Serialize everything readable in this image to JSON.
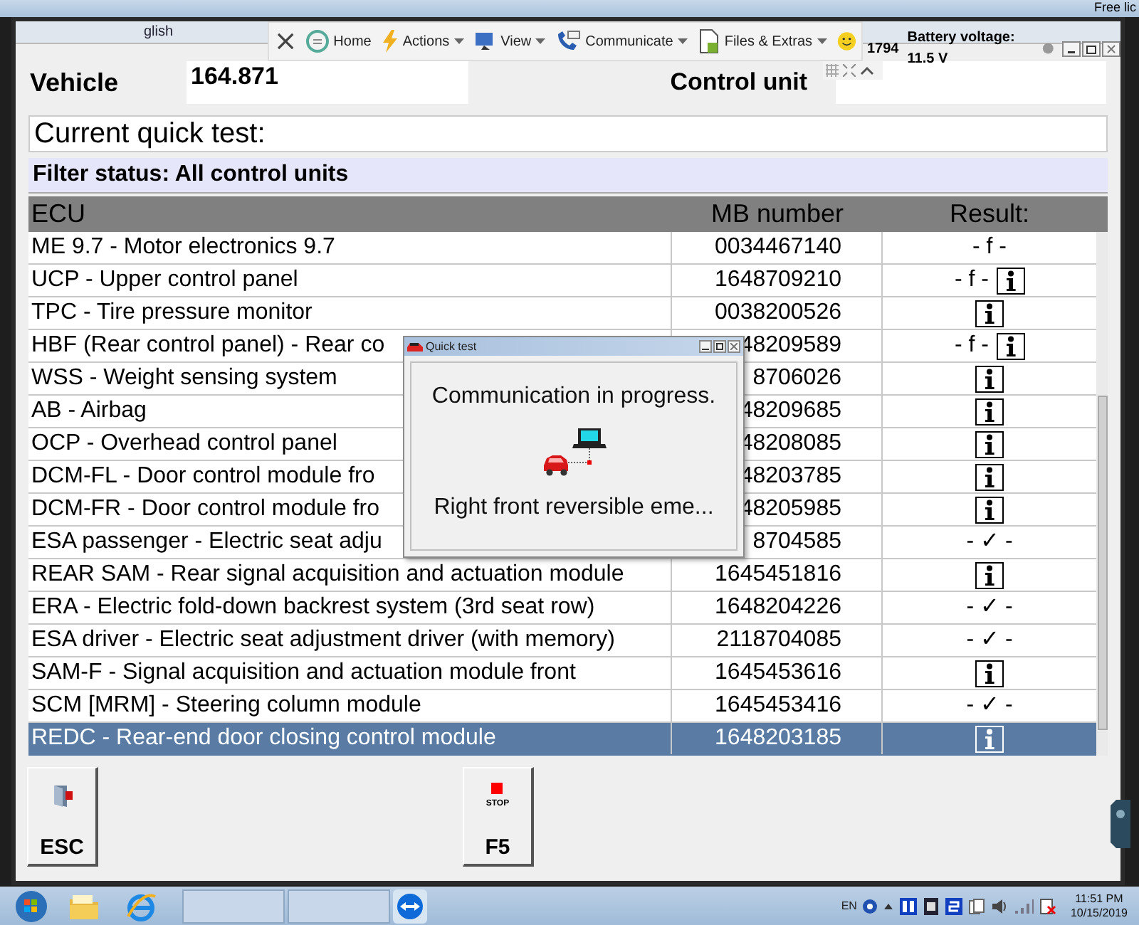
{
  "background_window": {
    "label": "Free lic"
  },
  "window": {
    "title": "glish",
    "status": "1794",
    "battery": "Battery voltage: 11.5 V"
  },
  "toolbar": [
    {
      "kind": "close"
    },
    {
      "kind": "home",
      "label": "Home",
      "dropdown": false
    },
    {
      "kind": "actions",
      "label": "Actions",
      "dropdown": true
    },
    {
      "kind": "view",
      "label": "View",
      "dropdown": true
    },
    {
      "kind": "communicate",
      "label": "Communicate",
      "dropdown": true
    },
    {
      "kind": "files",
      "label": "Files & Extras",
      "dropdown": true
    },
    {
      "kind": "smiley"
    }
  ],
  "vehicle": {
    "label": "Vehicle",
    "value": "164.871"
  },
  "control_unit": {
    "label": "Control unit"
  },
  "quick_test": "Current quick test:",
  "filter_status": "Filter status: All control units",
  "table": {
    "columns": [
      "ECU",
      "MB number",
      "Result:"
    ],
    "rows": [
      {
        "ecu": "ME 9.7 - Motor electronics 9.7",
        "mb": "0034467140",
        "result": "- f -",
        "info": false,
        "selected": false
      },
      {
        "ecu": "UCP - Upper control panel",
        "mb": "1648709210",
        "result": "- f -",
        "info": true,
        "selected": false
      },
      {
        "ecu": "TPC - Tire pressure monitor",
        "mb": "0038200526",
        "info": true,
        "selected": false
      },
      {
        "ecu": "HBF (Rear control panel) - Rear co",
        "mb": "48209589",
        "result": "- f -",
        "info": true,
        "selected": false
      },
      {
        "ecu": "WSS - Weight sensing system",
        "mb": "8706026",
        "info": true,
        "selected": false
      },
      {
        "ecu": "AB - Airbag",
        "mb": "48209685",
        "info": true,
        "selected": false
      },
      {
        "ecu": "OCP - Overhead control panel",
        "mb": "48208085",
        "info": true,
        "selected": false
      },
      {
        "ecu": "DCM-FL - Door control module fro",
        "mb": "48203785",
        "info": true,
        "selected": false
      },
      {
        "ecu": "DCM-FR - Door control module fro",
        "mb": "48205985",
        "info": true,
        "selected": false
      },
      {
        "ecu": "ESA passenger - Electric seat adju",
        "mb": "8704585",
        "result": "- ✓ -",
        "info": false,
        "selected": false
      },
      {
        "ecu": "REAR SAM - Rear signal acquisition and actuation module",
        "mb": "1645451816",
        "info": true,
        "selected": false
      },
      {
        "ecu": "ERA - Electric fold-down backrest system (3rd seat row)",
        "mb": "1648204226",
        "result": "- ✓ -",
        "info": false,
        "selected": false
      },
      {
        "ecu": "ESA driver - Electric seat adjustment driver (with memory)",
        "mb": "2118704085",
        "result": "- ✓ -",
        "info": false,
        "selected": false
      },
      {
        "ecu": "SAM-F - Signal acquisition and actuation module front",
        "mb": "1645453616",
        "info": true,
        "selected": false
      },
      {
        "ecu": "SCM [MRM] - Steering column module",
        "mb": "1645453416",
        "result": "- ✓ -",
        "info": false,
        "selected": false
      },
      {
        "ecu": "REDC - Rear-end door closing control module",
        "mb": "1648203185",
        "info": true,
        "selected": true
      }
    ]
  },
  "dialog": {
    "title": "Quick test",
    "message": "Communication in progress.",
    "status": "Right front reversible eme..."
  },
  "buttons": [
    {
      "kind": "esc",
      "label": "ESC"
    },
    {
      "kind": "stop",
      "caption": "STOP",
      "label": "F5"
    }
  ],
  "taskbar": {
    "items": [
      {
        "kind": "start"
      },
      {
        "kind": "explorer"
      },
      {
        "kind": "browser"
      },
      {
        "kind": "window"
      },
      {
        "kind": "window"
      },
      {
        "kind": "remote"
      }
    ],
    "language": "EN",
    "time": "11:51 PM",
    "date": "10/15/2019"
  }
}
